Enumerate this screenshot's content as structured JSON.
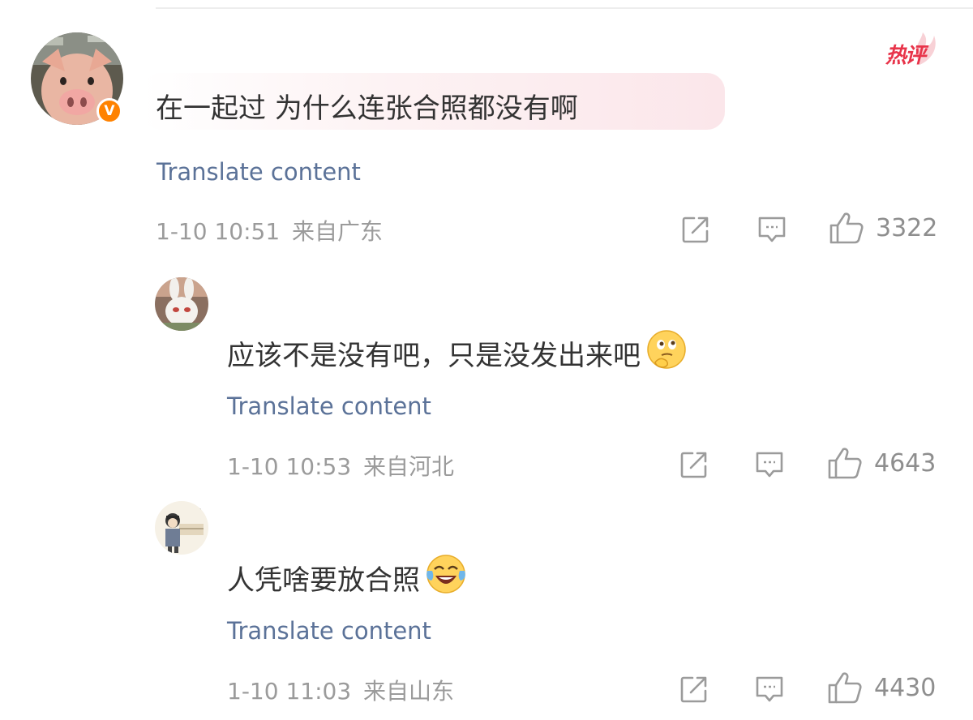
{
  "main_comment": {
    "text": "在一起过 为什么连张合照都没有啊",
    "translate_label": "Translate content",
    "timestamp": "1-10 10:51",
    "location": "来自广东",
    "likes": "3322",
    "hot_label": "热评",
    "verified_mark": "V",
    "avatar": "pig-avatar"
  },
  "replies": [
    {
      "text": "应该不是没有吧，只是没发出来吧",
      "emoji": "thinking-emoji",
      "translate_label": "Translate content",
      "timestamp": "1-10 10:53",
      "location": "来自河北",
      "likes": "4643",
      "avatar": "rabbit-avatar"
    },
    {
      "text": "人凭啥要放合照",
      "emoji": "laughing-tears-emoji",
      "translate_label": "Translate content",
      "timestamp": "1-10 11:03",
      "location": "来自山东",
      "likes": "4430",
      "avatar": "cartoon-person-avatar"
    }
  ],
  "colors": {
    "text": "#333333",
    "link": "#5b7298",
    "meta": "#9b9b9b",
    "hot": "#e8344a",
    "verified": "#ff8200"
  }
}
